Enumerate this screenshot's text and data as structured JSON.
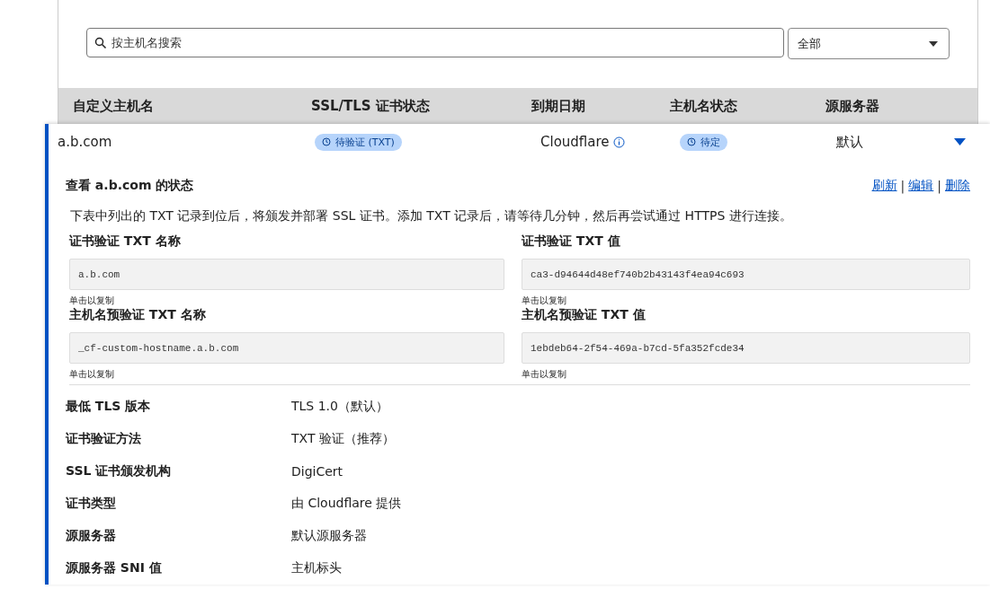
{
  "search": {
    "placeholder": "按主机名搜索"
  },
  "filter": {
    "value": "全部"
  },
  "table": {
    "columns": [
      "自定义主机名",
      "SSL/TLS 证书状态",
      "到期日期",
      "主机名状态",
      "源服务器"
    ],
    "rows": [
      {
        "hostname": "a.b.com",
        "ssl_status": "待验证 (TXT)",
        "expiry": "Cloudflare",
        "hostname_status": "待定",
        "origin": "默认",
        "expanded": true
      }
    ]
  },
  "details": {
    "title": "查看 a.b.com 的状态",
    "actions": [
      "刷新",
      "编辑",
      "删除"
    ],
    "action_separator": "|",
    "description": "下表中列出的 TXT 记录到位后，将颁发并部署 SSL 证书。添加 TXT 记录后，请等待几分钟，然后再尝试通过 HTTPS 进行连接。",
    "records": [
      {
        "label": "证书验证 TXT 名称",
        "value": "a.b.com",
        "hint": "单击以复制"
      },
      {
        "label": "证书验证 TXT 值",
        "value": "ca3-d94644d48ef740b2b43143f4ea94c693",
        "hint": "单击以复制"
      },
      {
        "label": "主机名预验证 TXT 名称",
        "value": "_cf-custom-hostname.a.b.com",
        "hint": "单击以复制"
      },
      {
        "label": "主机名预验证 TXT 值",
        "value": "1ebdeb64-2f54-469a-b7cd-5fa352fcde34",
        "hint": "单击以复制"
      }
    ],
    "properties": [
      {
        "label": "最低 TLS 版本",
        "value": "TLS 1.0（默认）"
      },
      {
        "label": "证书验证方法",
        "value": "TXT 验证（推荐）"
      },
      {
        "label": "SSL 证书颁发机构",
        "value": "DigiCert"
      },
      {
        "label": "证书类型",
        "value": "由 Cloudflare 提供"
      },
      {
        "label": "源服务器",
        "value": "默认源服务器"
      },
      {
        "label": "源服务器 SNI 值",
        "value": "主机标头"
      }
    ]
  }
}
